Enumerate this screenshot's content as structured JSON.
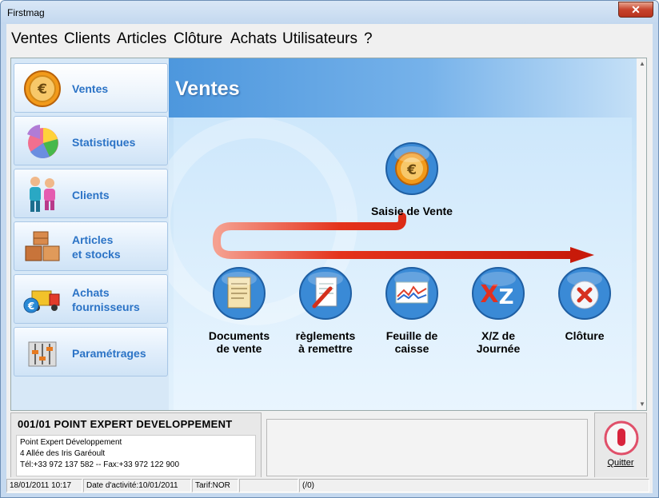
{
  "window": {
    "title": "Firstmag",
    "close_glyph": "✕"
  },
  "menu": [
    "Ventes",
    "Clients",
    "Articles",
    "Clôture",
    "Achats",
    "Utilisateurs",
    "?"
  ],
  "sidebar": {
    "items": [
      {
        "label_lines": [
          "Ventes"
        ],
        "icon": "euro-coin-icon"
      },
      {
        "label_lines": [
          "Statistiques"
        ],
        "icon": "pie-chart-icon"
      },
      {
        "label_lines": [
          "Clients"
        ],
        "icon": "people-icon"
      },
      {
        "label_lines": [
          "Articles",
          "et stocks"
        ],
        "icon": "boxes-icon"
      },
      {
        "label_lines": [
          "Achats",
          "fournisseurs"
        ],
        "icon": "truck-icon"
      },
      {
        "label_lines": [
          "Paramétrages"
        ],
        "icon": "sliders-icon"
      }
    ]
  },
  "main": {
    "title": "Ventes",
    "primary_action": {
      "label": "Saisie de Vente",
      "icon": "euro-coin-icon"
    },
    "actions": [
      {
        "label_lines": [
          "Documents",
          "de vente"
        ],
        "icon": "document-scroll-icon"
      },
      {
        "label_lines": [
          "règlements",
          "à remettre"
        ],
        "icon": "receipt-pen-icon"
      },
      {
        "label_lines": [
          "Feuille de",
          "caisse"
        ],
        "icon": "chart-sheet-icon"
      },
      {
        "label_lines": [
          "X/Z de",
          "Journée"
        ],
        "icon": "xz-icon"
      },
      {
        "label_lines": [
          "Clôture"
        ],
        "icon": "close-circle-icon"
      }
    ]
  },
  "footer": {
    "company_name": "001/01 POINT EXPERT DEVELOPPEMENT",
    "address_lines": [
      "Point Expert Développement",
      "4 Allée des Iris Garéoult",
      "Tél:+33 972 137 582 -- Fax:+33 972 122 900"
    ],
    "quit_label": "Quitter"
  },
  "status": {
    "datetime": "18/01/2011 10:17",
    "activity_date": "Date d'activité:10/01/2011",
    "tarif": "Tarif:NOR",
    "empty": "",
    "counter": "(/0)"
  },
  "colors": {
    "accent_blue": "#2b73c6",
    "arrow_red": "#e4321b",
    "header_blue": "#4d97dd"
  }
}
